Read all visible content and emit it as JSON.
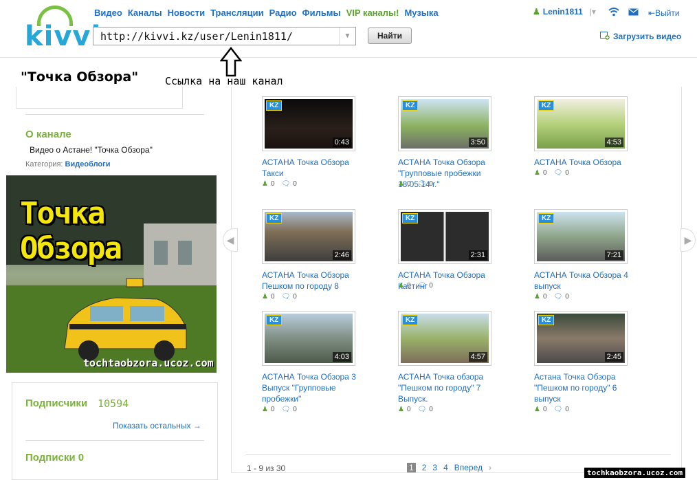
{
  "header": {
    "logo_text": "kivvi",
    "nav": [
      "Видео",
      "Каналы",
      "Новости",
      "Трансляции",
      "Радио",
      "Фильмы",
      "VIP каналы!",
      "Музыка"
    ],
    "url": "http://kivvi.kz/user/Lenin1811/",
    "find_button": "Найти",
    "username": "Lenin1811",
    "exit_label": "Выйти",
    "upload_label": "Загрузить видео"
  },
  "annotation": {
    "channel_title": "\"Точка Обзора\"",
    "note": "Ссылка на наш канал"
  },
  "sidebar": {
    "about_title": "О канале",
    "about_desc": "Видео о Астане! \"Точка Обзора\"",
    "category_label": "Категория:",
    "category_value": "Видеоблоги",
    "banner_title": "Точка Обзора",
    "banner_url": "tochtaobzora.ucoz.com",
    "subscribers_label": "Подписчики",
    "subscribers_count": "10594",
    "show_more": "Показать остальных →",
    "subscriptions_label": "Подписки 0"
  },
  "videos": [
    {
      "title": "АСТАНА Точка Обзора Такси",
      "duration": "0:43",
      "views": "0",
      "comments": "0",
      "badge": "KZ"
    },
    {
      "title": "АСТАНА Точка Обзора \"Групповые пробежки 18.05.14 г.\"",
      "duration": "3:50",
      "views": "0",
      "comments": "0",
      "badge": "KZ"
    },
    {
      "title": "АСТАНА Точка Обзора",
      "duration": "4:53",
      "views": "0",
      "comments": "0",
      "badge": "KZ"
    },
    {
      "title": "АСТАНА Точка Обзора Пешком по городу 8",
      "duration": "2:46",
      "views": "0",
      "comments": "0",
      "badge": "KZ"
    },
    {
      "title": "АСТАНА Точка Обзора Кастинг",
      "duration": "2:31",
      "views": "0",
      "comments": "0",
      "badge": "KZ"
    },
    {
      "title": "АСТАНА Точка Обзора 4 выпуск",
      "duration": "7:21",
      "views": "0",
      "comments": "0",
      "badge": "KZ"
    },
    {
      "title": "АСТАНА Точка Обзора 3 Выпуск \"Групповые пробежки\"",
      "duration": "4:03",
      "views": "0",
      "comments": "0",
      "badge": "KZ"
    },
    {
      "title": "АСТАНА Точка обзора \"Пешком по городу\" 7 Выпуск.",
      "duration": "4:57",
      "views": "0",
      "comments": "0",
      "badge": "KZ"
    },
    {
      "title": "Астана Точка Обзора \"Пешком по городу\" 6 выпуск",
      "duration": "2:45",
      "views": "0",
      "comments": "0",
      "badge": "KZ"
    }
  ],
  "pagination": {
    "range": "1 - 9 из 30",
    "pages": [
      "1",
      "2",
      "3",
      "4"
    ],
    "next": "Вперед",
    "caret": "›"
  },
  "watermark": "tochkaobzora.ucoz.com",
  "colors": {
    "link": "#1e6fc4",
    "green": "#7ab23a",
    "badge": "#2b8ed8"
  }
}
